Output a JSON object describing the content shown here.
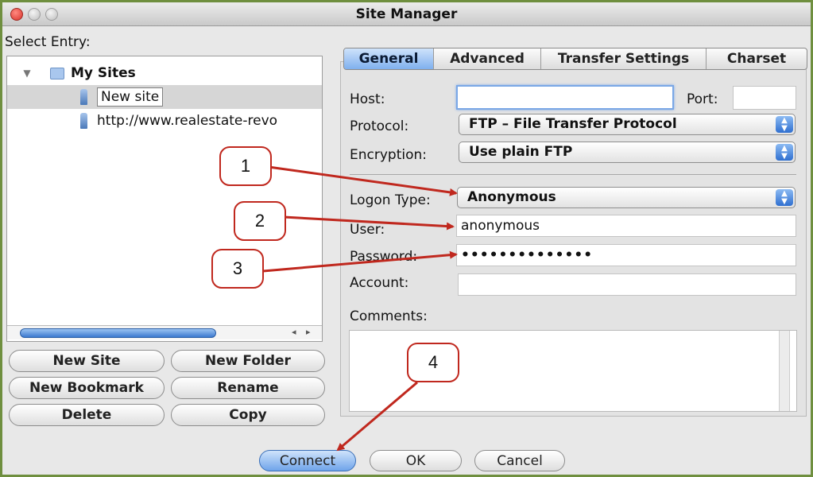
{
  "window": {
    "title": "Site Manager"
  },
  "tree": {
    "heading": "Select Entry:",
    "root": "My Sites",
    "items": [
      "New site",
      "http://www.realestate-revo"
    ]
  },
  "left_buttons": {
    "new_site": "New Site",
    "new_folder": "New Folder",
    "new_bookmark": "New Bookmark",
    "rename": "Rename",
    "delete": "Delete",
    "copy": "Copy"
  },
  "tabs": [
    "General",
    "Advanced",
    "Transfer Settings",
    "Charset"
  ],
  "active_tab": "General",
  "general": {
    "host_label": "Host:",
    "host_value": "",
    "port_label": "Port:",
    "port_value": "",
    "protocol_label": "Protocol:",
    "protocol_value": "FTP – File Transfer Protocol",
    "encryption_label": "Encryption:",
    "encryption_value": "Use plain FTP",
    "logon_label": "Logon Type:",
    "logon_value": "Anonymous",
    "user_label": "User:",
    "user_value": "anonymous",
    "password_label": "Password:",
    "password_value": "••••••••••••••",
    "account_label": "Account:",
    "account_value": "",
    "comments_label": "Comments:"
  },
  "bottom_buttons": {
    "connect": "Connect",
    "ok": "OK",
    "cancel": "Cancel"
  },
  "callouts": [
    "1",
    "2",
    "3",
    "4"
  ],
  "colors": {
    "annotation": "#c0281e",
    "accent": "#3c79cf",
    "frame": "#6f8f3f"
  }
}
